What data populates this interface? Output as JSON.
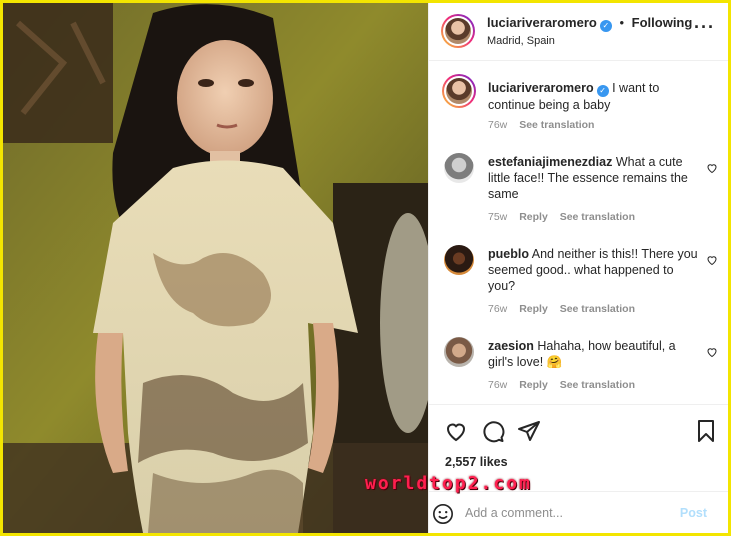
{
  "header": {
    "username": "luciariveraromero",
    "separator": "•",
    "follow_label": "Following",
    "location": "Madrid, Spain",
    "more_icon": "more-horizontal-icon"
  },
  "caption": {
    "username": "luciariveraromero",
    "text": "I want to continue being a baby",
    "age": "76w",
    "see_translation": "See translation"
  },
  "comments": [
    {
      "username": "estefaniajimenezdiaz",
      "text": "What a cute little face!! The essence remains the same",
      "age": "75w",
      "reply": "Reply",
      "see_translation": "See translation"
    },
    {
      "username": "pueblo",
      "text": "And neither is this!! There you seemed good.. what happened to you?",
      "age": "76w",
      "reply": "Reply",
      "see_translation": "See translation"
    },
    {
      "username": "zaesion",
      "text": "Hahaha, how beautiful, a girl's love! 🤗",
      "age": "76w",
      "reply": "Reply",
      "see_translation": "See translation"
    }
  ],
  "actions": {
    "like_icon": "heart-icon",
    "comment_icon": "comment-icon",
    "share_icon": "paper-plane-icon",
    "save_icon": "bookmark-icon"
  },
  "likes": "2,557 likes",
  "time_ago": "",
  "add_comment": {
    "placeholder": "Add a comment...",
    "post_label": "Post",
    "emoji_icon": "smile-icon"
  },
  "watermark": "worldtop2.com",
  "colors": {
    "frame": "#f3e500",
    "verified": "#3897f0",
    "post_disabled": "#b2dffc",
    "muted": "#8e8e8e",
    "watermark": "#ff1f4f"
  }
}
